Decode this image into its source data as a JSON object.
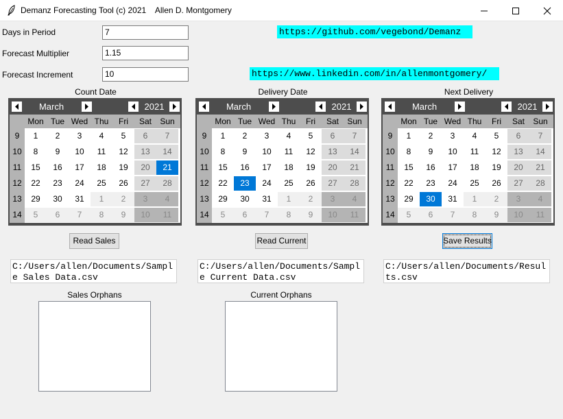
{
  "window": {
    "title": "Demanz Forecasting Tool (c) 2021    Allen D. Montgomery"
  },
  "fields": [
    {
      "label": "Days in Period",
      "value": "7"
    },
    {
      "label": "Forecast Multiplier",
      "value": "1.15"
    },
    {
      "label": "Forecast Increment",
      "value": "10"
    }
  ],
  "links": {
    "github": "https://github.com/vegebond/Demanz",
    "linkedin": "https://www.linkedin.com/in/allenmontgomery/"
  },
  "calendars": [
    {
      "title": "Count Date",
      "month": "March",
      "year": "2021",
      "selected": "21"
    },
    {
      "title": "Delivery Date",
      "month": "March",
      "year": "2021",
      "selected": "23"
    },
    {
      "title": "Next Delivery",
      "month": "March",
      "year": "2021",
      "selected": "30"
    }
  ],
  "weekdays": [
    "Mon",
    "Tue",
    "Wed",
    "Thu",
    "Fri",
    "Sat",
    "Sun"
  ],
  "weeks": [
    {
      "wk": "9",
      "days": [
        "1",
        "2",
        "3",
        "4",
        "5",
        "6",
        "7"
      ]
    },
    {
      "wk": "10",
      "days": [
        "8",
        "9",
        "10",
        "11",
        "12",
        "13",
        "14"
      ]
    },
    {
      "wk": "11",
      "days": [
        "15",
        "16",
        "17",
        "18",
        "19",
        "20",
        "21"
      ]
    },
    {
      "wk": "12",
      "days": [
        "22",
        "23",
        "24",
        "25",
        "26",
        "27",
        "28"
      ]
    },
    {
      "wk": "13",
      "days": [
        "29",
        "30",
        "31",
        "1",
        "2",
        "3",
        "4"
      ]
    },
    {
      "wk": "14",
      "days": [
        "5",
        "6",
        "7",
        "8",
        "9",
        "10",
        "11"
      ]
    }
  ],
  "buttons": {
    "read_sales": "Read Sales",
    "read_current": "Read Current",
    "save_results": "Save Results"
  },
  "paths": {
    "sales": "C:/Users/allen/Documents/Sample Sales Data.csv",
    "current": "C:/Users/allen/Documents/Sample Current Data.csv",
    "results": "C:/Users/allen/Documents/Results.csv"
  },
  "orphans": {
    "sales_label": "Sales Orphans",
    "current_label": "Current Orphans"
  },
  "colors": {
    "link_bg": "#00ffff",
    "selected_day": "#0078d7",
    "calendar_header": "#4d4d4d"
  },
  "icons": [
    "feather-icon",
    "minimize-icon",
    "maximize-icon",
    "close-icon",
    "arrow-left-icon",
    "arrow-right-icon"
  ]
}
